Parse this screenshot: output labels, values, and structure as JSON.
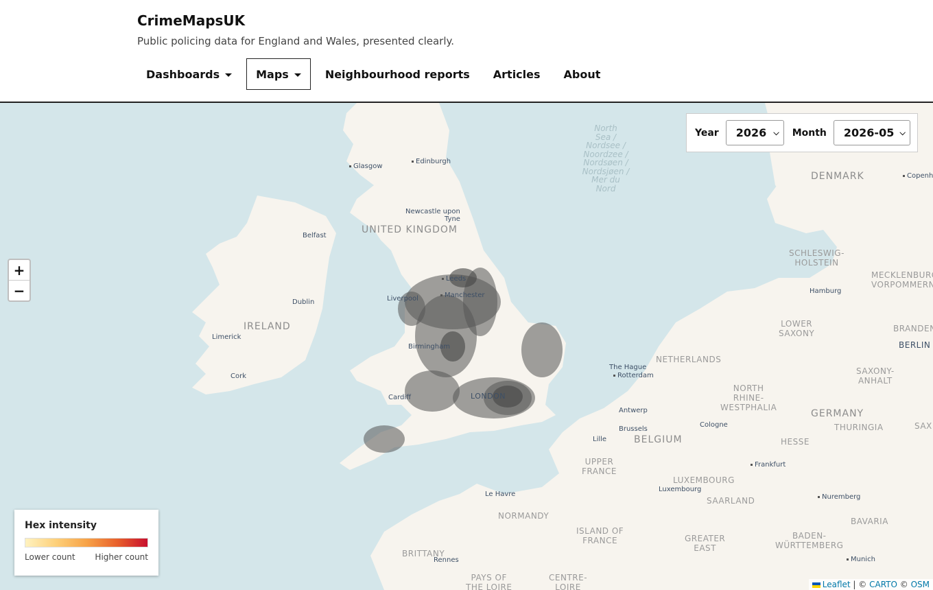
{
  "header": {
    "brand": "CrimeMapsUK",
    "tagline": "Public policing data for England and Wales, presented clearly."
  },
  "nav": {
    "dashboards": "Dashboards",
    "maps": "Maps",
    "neighbourhood_reports": "Neighbourhood reports",
    "articles": "Articles",
    "about": "About"
  },
  "filters": {
    "year_label": "Year",
    "year_value": "2026",
    "month_label": "Month",
    "month_value": "2026-05"
  },
  "zoom": {
    "in": "+",
    "out": "−"
  },
  "legend": {
    "title": "Hex intensity",
    "low_label": "Lower count",
    "high_label": "Higher count",
    "colors": [
      "#fff2c0",
      "#fdd07a",
      "#f7a348",
      "#e8612c",
      "#c8102e"
    ]
  },
  "map_labels": {
    "glasgow": "Glasgow",
    "edinburgh": "Edinburgh",
    "newcastle": "Newcastle upon",
    "tyne": "Tyne",
    "united_kingdom": "UNITED KINGDOM",
    "belfast": "Belfast",
    "leeds": "Leeds",
    "manchester": "Manchester",
    "liverpool": "Liverpool",
    "dublin": "Dublin",
    "ireland": "IRELAND",
    "limerick": "Limerick",
    "birmingham": "Birmingham",
    "cork": "Cork",
    "cardiff": "Cardiff",
    "london": "LONDON",
    "north_sea": "North\nSea /\nNordsee /\nNoordzee /\nNordsøen /\nNordsjøen /\nMer du\nNord",
    "denmark": "DENMARK",
    "copenhagen": "Copenh",
    "schleswig": "SCHLESWIG-\nHOLSTEIN",
    "mecklenburg": "MECKLENBURG\nVORPOMMERN",
    "hamburg": "Hamburg",
    "lower_saxony": "LOWER\nSAXONY",
    "branden": "BRANDEN",
    "berlin": "BERLIN",
    "netherlands": "NETHERLANDS",
    "the_hague": "The Hague",
    "rotterdam": "Rotterdam",
    "saxony_anhalt": "SAXONY-\nANHALT",
    "nrw": "NORTH\nRHINE-\nWESTPHALIA",
    "germany": "GERMANY",
    "thuringia": "THURINGIA",
    "saxony": "SAX",
    "antwerp": "Antwerp",
    "brussels": "Brussels",
    "belgium": "BELGIUM",
    "cologne": "Cologne",
    "hesse": "HESSE",
    "lille": "Lille",
    "upper_france": "UPPER\nFRANCE",
    "luxembourg_region": "LUXEMBOURG",
    "luxembourg": "Luxembourg",
    "frankfurt": "Frankfurt",
    "saarland": "SAARLAND",
    "le_havre": "Le Havre",
    "nuremberg": "Nuremberg",
    "normandy": "NORMANDY",
    "ile_de_france": "ISLAND OF\nFRANCE",
    "greater_east": "GREATER\nEAST",
    "bavaria": "BAVARIA",
    "baden": "BADEN-\nWÜRTTEMBERG",
    "brittany": "BRITTANY",
    "rennes": "Rennes",
    "munich": "Munich",
    "pays_loire": "PAYS OF\nTHE LOIRE",
    "centre_loire": "CENTRE-\nLOIRE"
  },
  "attribution": {
    "leaflet": "Leaflet",
    "sep1": " | © ",
    "carto": "CARTO",
    "sep2": " © ",
    "osm": "OSM"
  }
}
